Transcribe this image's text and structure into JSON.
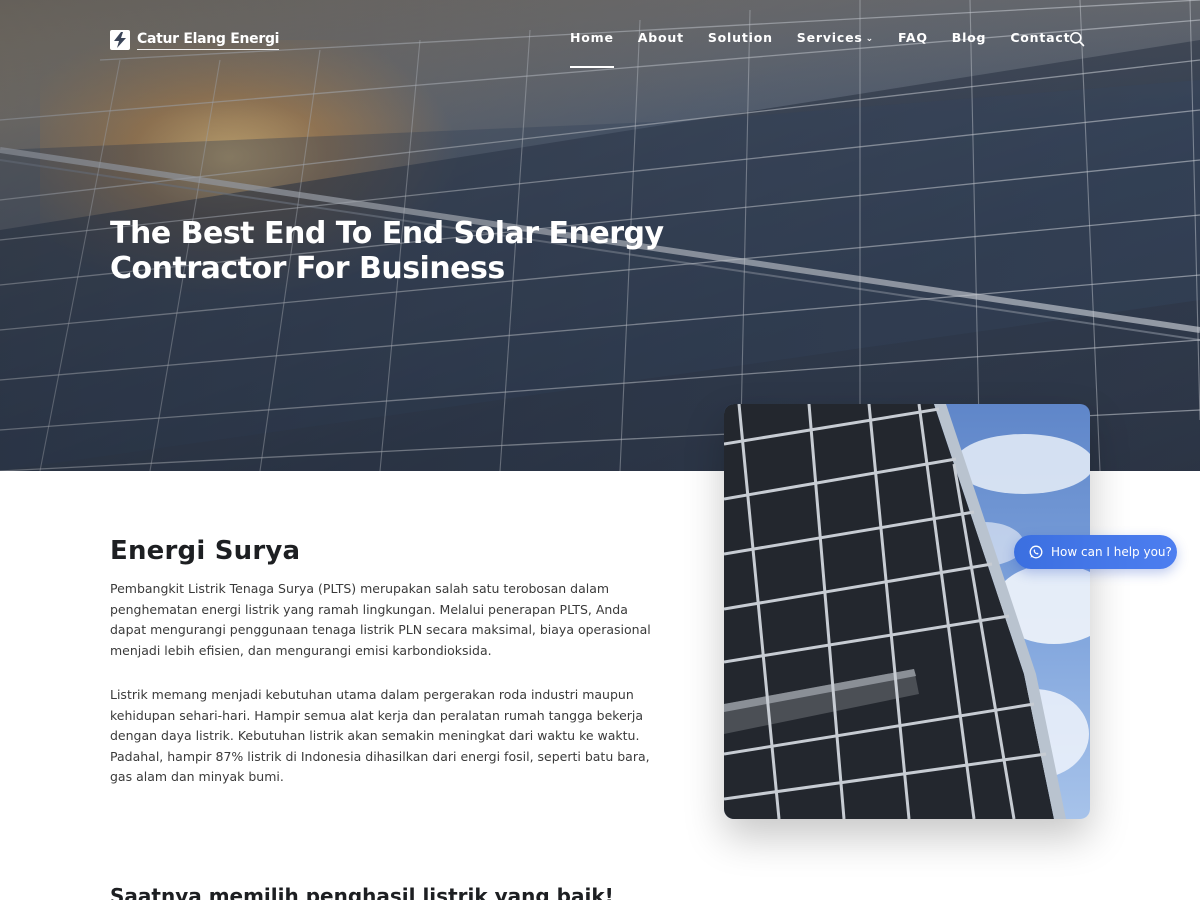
{
  "brand": {
    "name": "Catur Elang Energi",
    "logo_icon": "lightning-bolt-icon"
  },
  "nav": {
    "items": [
      {
        "label": "Home",
        "active": true
      },
      {
        "label": "About",
        "active": false
      },
      {
        "label": "Solution",
        "active": false
      },
      {
        "label": "Services",
        "active": false,
        "has_dropdown": true
      },
      {
        "label": "FAQ",
        "active": false
      },
      {
        "label": "Blog",
        "active": false
      },
      {
        "label": "Contact",
        "active": false
      }
    ],
    "dropdown_glyph": "⌄",
    "search_icon": "search-icon"
  },
  "hero": {
    "title_line1": "The Best End To End Solar Energy",
    "title_line2": "Contractor For Business"
  },
  "content": {
    "section_title": "Energi Surya",
    "paragraph_1": "Pembangkit Listrik Tenaga Surya (PLTS) merupakan salah satu terobosan dalam penghematan energi listrik yang ramah lingkungan. Melalui penerapan PLTS, Anda dapat mengurangi penggunaan tenaga listrik PLN secara maksimal, biaya operasional menjadi lebih efisien, dan mengurangi emisi karbondioksida.",
    "paragraph_2": "Listrik memang menjadi kebutuhan utama dalam pergerakan roda industri maupun kehidupan sehari-hari. Hampir semua alat kerja dan peralatan rumah tangga bekerja dengan daya listrik. Kebutuhan listrik akan semakin meningkat dari waktu ke waktu. Padahal, hampir 87% listrik di Indonesia dihasilkan dari energi fosil, seperti batu bara, gas alam dan minyak bumi.",
    "subsection_title": "Saatnya memilih penghasil listrik yang baik!"
  },
  "chat": {
    "label": "How can I help you?",
    "icon": "whatsapp-icon"
  },
  "colors": {
    "chat_accent": "#3b6fe0",
    "text_dark": "#1d1f22",
    "text_body": "#3a3a3a"
  }
}
